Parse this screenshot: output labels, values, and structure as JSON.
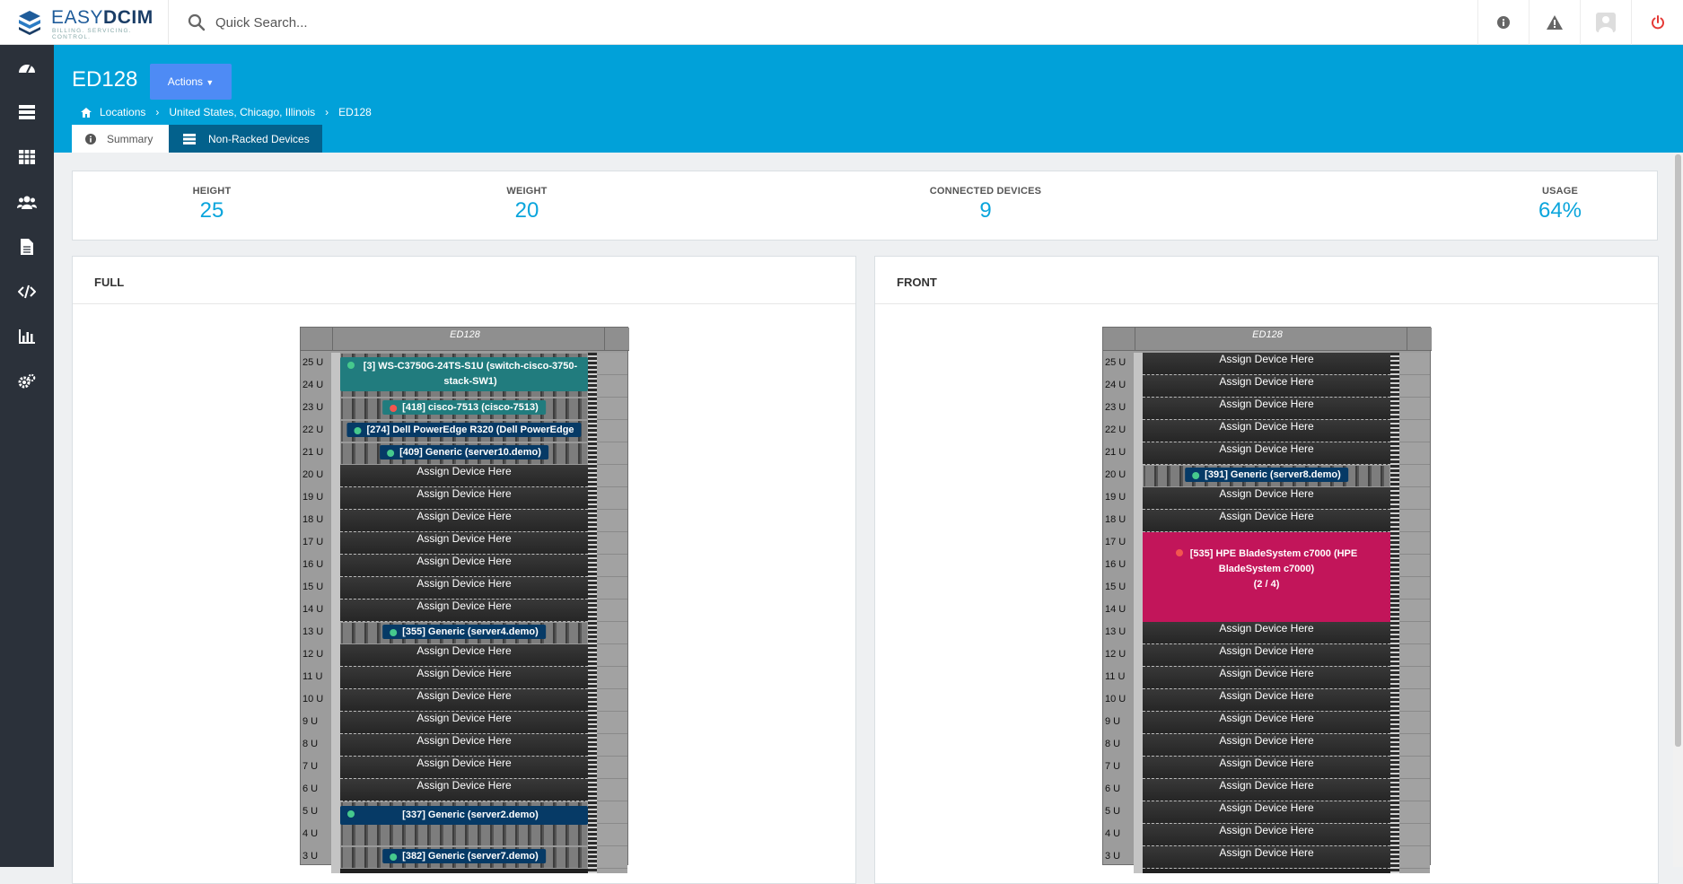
{
  "app": {
    "name": "EASYDCIM",
    "name_a": "EASY",
    "name_b": "DCIM",
    "tagline": "BILLING. SERVICING. CONTROL."
  },
  "search": {
    "placeholder": "Quick Search..."
  },
  "topbar": {
    "icons": [
      "info-icon",
      "warning-icon",
      "user-avatar-icon",
      "power-icon"
    ]
  },
  "sidebar": {
    "items": [
      "dashboard-icon",
      "servers-icon",
      "table-icon",
      "users-icon",
      "document-icon",
      "code-icon",
      "chart-icon",
      "settings-icon"
    ]
  },
  "header": {
    "title": "ED128",
    "actions_label": "Actions",
    "breadcrumb": [
      "Locations",
      "United States, Chicago, Illinois",
      "ED128"
    ],
    "tabs": [
      "Summary",
      "Non-Racked Devices"
    ]
  },
  "stats": [
    {
      "label": "HEIGHT",
      "value": "25"
    },
    {
      "label": "WEIGHT",
      "value": "20"
    },
    {
      "label": "CONNECTED DEVICES",
      "value": "9"
    },
    {
      "label": "USAGE",
      "value": "64%"
    }
  ],
  "panels": {
    "full": "FULL",
    "front": "FRONT"
  },
  "rack_name": "ED128",
  "assign_label": "Assign Device Here",
  "full_rack": {
    "units": [
      "25 U",
      "24 U",
      "23 U",
      "22 U",
      "21 U",
      "20 U",
      "19 U",
      "18 U",
      "17 U",
      "16 U",
      "15 U",
      "14 U",
      "13 U",
      "12 U",
      "11 U",
      "10 U",
      "9 U",
      "8 U",
      "7 U",
      "6 U",
      "5 U",
      "4 U",
      "3 U"
    ],
    "devices": [
      {
        "top_u": 25,
        "size_u": 2,
        "label": "[3] WS-C3750G-24TS-S1U (switch-cisco-3750-stack-SW1)",
        "status": "green",
        "style": "teal"
      },
      {
        "top_u": 23,
        "size_u": 1,
        "label": "[418] cisco-7513 (cisco-7513)",
        "status": "red",
        "style": "teal"
      },
      {
        "top_u": 22,
        "size_u": 1,
        "label": "[274] Dell PowerEdge R320 (Dell PowerEdge",
        "status": "green",
        "style": "navy"
      },
      {
        "top_u": 21,
        "size_u": 1,
        "label": "[409] Generic (server10.demo)",
        "status": "green",
        "style": "navy"
      },
      {
        "top_u": 13,
        "size_u": 1,
        "label": "[355] Generic (server4.demo)",
        "status": "green",
        "style": "navy"
      },
      {
        "top_u": 5,
        "size_u": 2,
        "label": "[337] Generic (server2.demo)",
        "status": "green",
        "style": "navy"
      },
      {
        "top_u": 3,
        "size_u": 1,
        "label": "[382] Generic (server7.demo)",
        "status": "green",
        "style": "navy"
      }
    ],
    "empty_units": [
      20,
      19,
      18,
      17,
      16,
      15,
      14,
      12,
      11,
      10,
      9,
      8,
      7,
      6
    ]
  },
  "front_rack": {
    "units": [
      "25 U",
      "24 U",
      "23 U",
      "22 U",
      "21 U",
      "20 U",
      "19 U",
      "18 U",
      "17 U",
      "16 U",
      "15 U",
      "14 U",
      "13 U",
      "12 U",
      "11 U",
      "10 U",
      "9 U",
      "8 U",
      "7 U",
      "6 U",
      "5 U",
      "4 U",
      "3 U"
    ],
    "devices": [
      {
        "top_u": 20,
        "size_u": 1,
        "label": "[391] Generic (server8.demo)",
        "status": "green",
        "style": "navy"
      }
    ],
    "blade": {
      "top_u": 17,
      "size_u": 4,
      "line1": "[535] HPE BladeSystem c7000 (HPE",
      "line2": "BladeSystem c7000)",
      "line3": "(2 / 4)",
      "status": "red",
      "color": "#c2155a"
    },
    "empty_units": [
      25,
      24,
      23,
      22,
      21,
      19,
      18,
      13,
      12,
      11,
      10,
      9,
      8,
      7,
      6,
      5,
      4,
      3
    ]
  },
  "colors": {
    "header": "#01a1d9",
    "sidebar": "#2b313a",
    "accent": "#0aa5dc",
    "actions": "#4e8bf5",
    "tab_active": "#03618c"
  }
}
